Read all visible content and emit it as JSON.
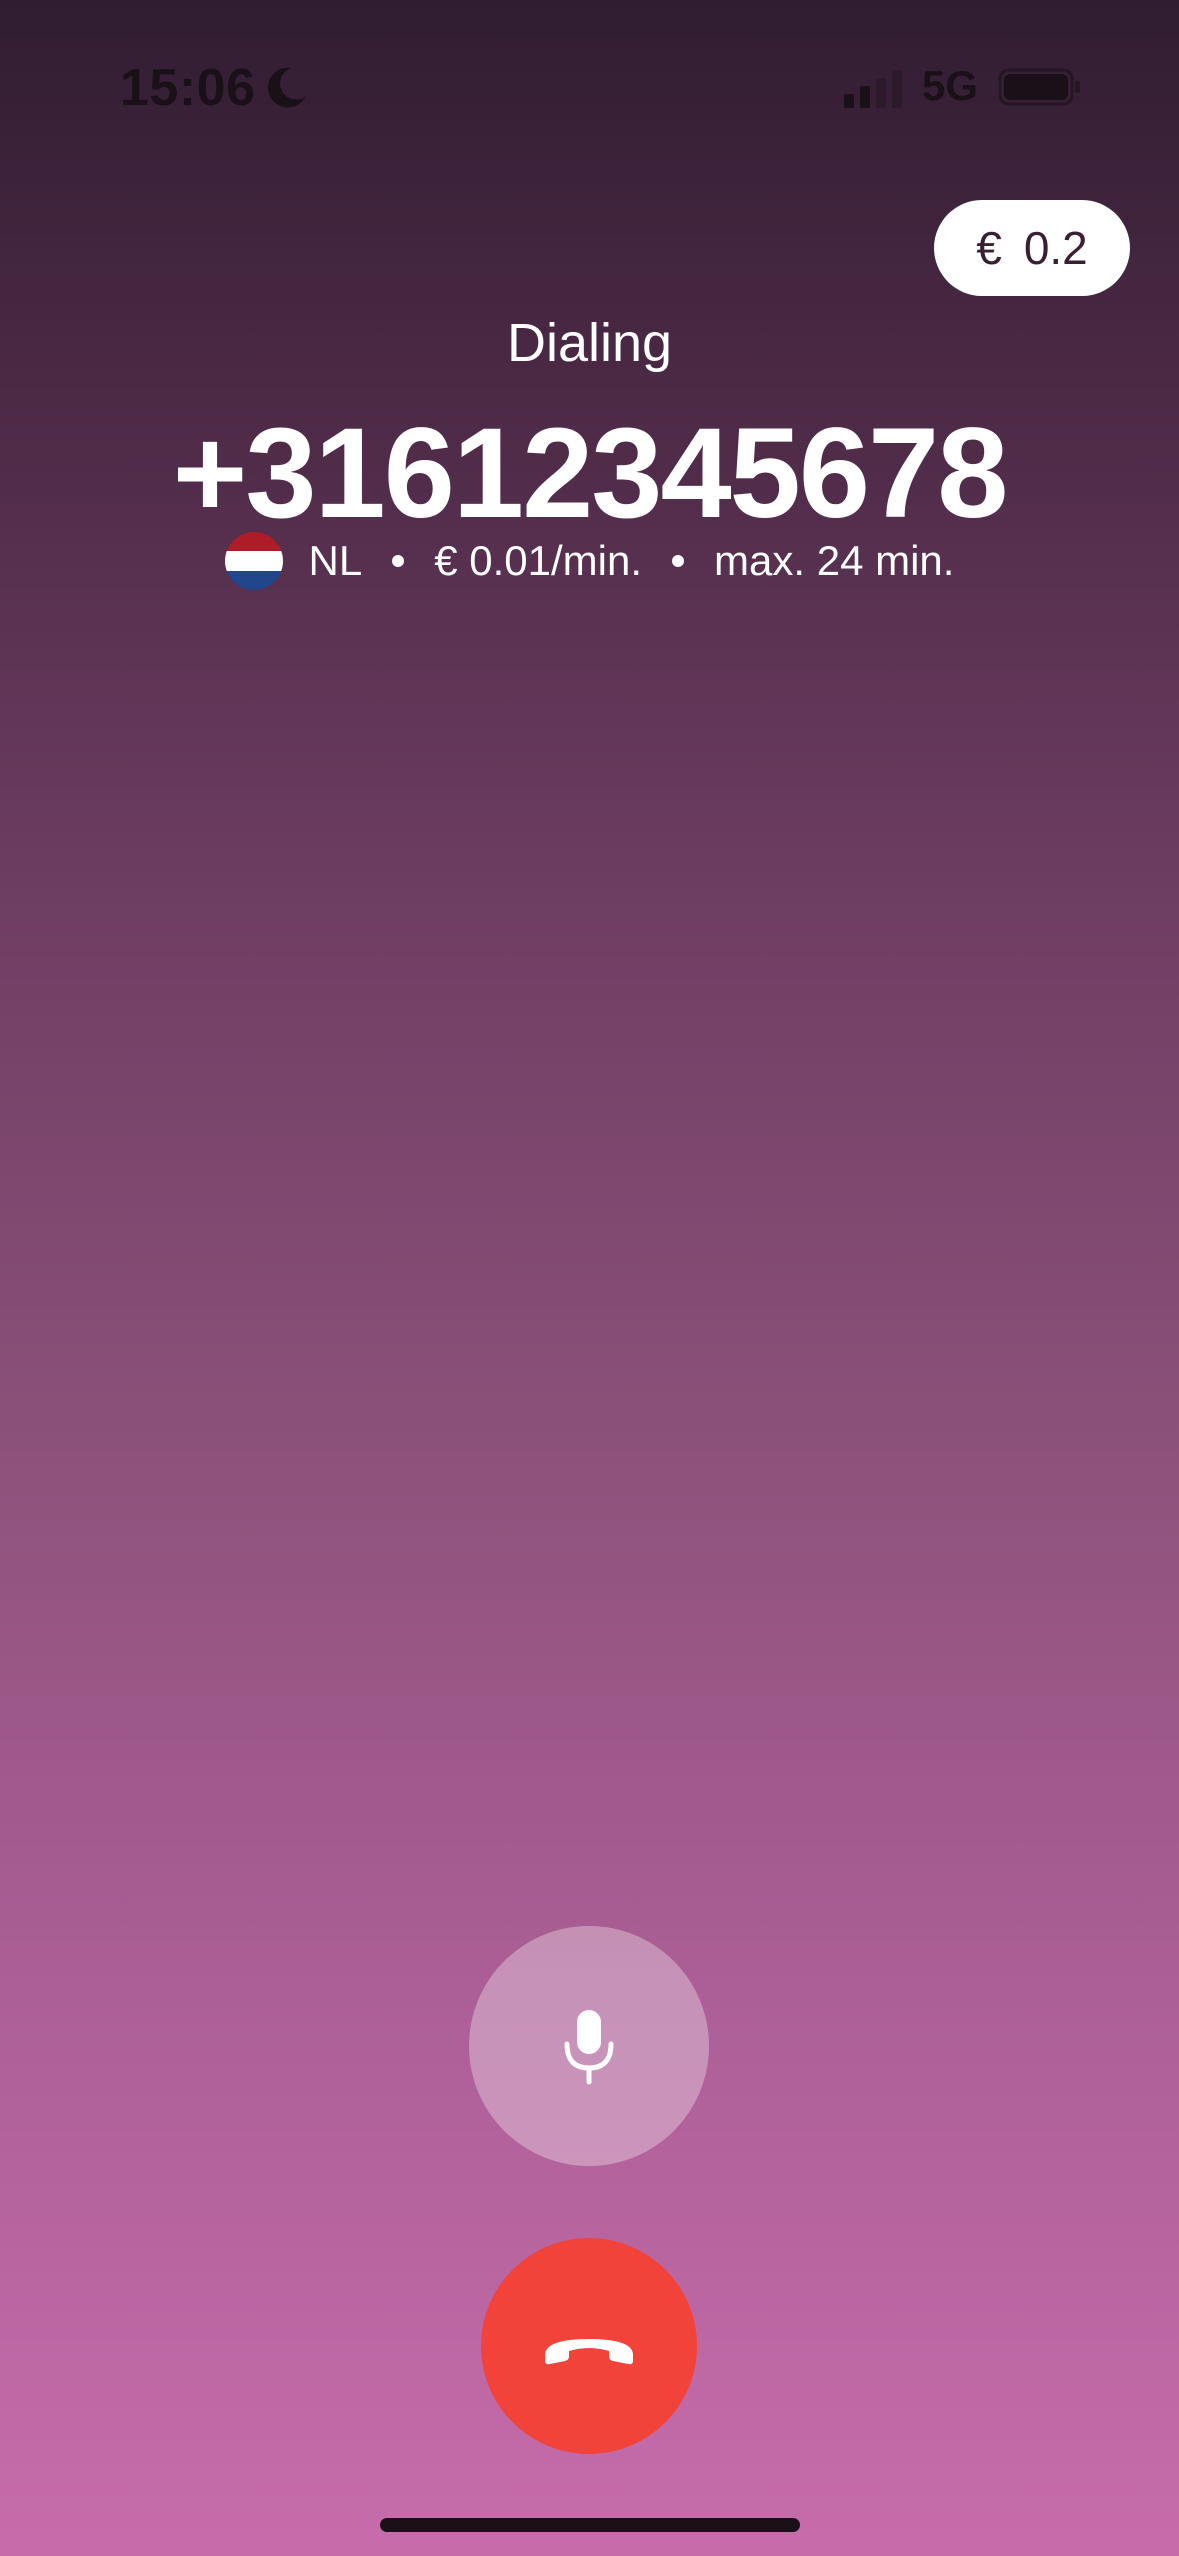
{
  "status_bar": {
    "time": "15:06",
    "network": "5G",
    "icons": [
      "moon-icon",
      "signal-icon",
      "battery-icon"
    ]
  },
  "balance": {
    "currency": "€",
    "amount": "0.2"
  },
  "call": {
    "status": "Dialing",
    "number": "+31612345678",
    "country_code": "NL",
    "rate": "€ 0.01/min.",
    "max_duration": "max. 24 min.",
    "flag_colors": [
      "#ae1c28",
      "#ffffff",
      "#21468b"
    ]
  },
  "controls": {
    "mute_icon": "microphone-icon",
    "end_call_icon": "hang-up-icon",
    "end_call_color": "#f2433a"
  }
}
